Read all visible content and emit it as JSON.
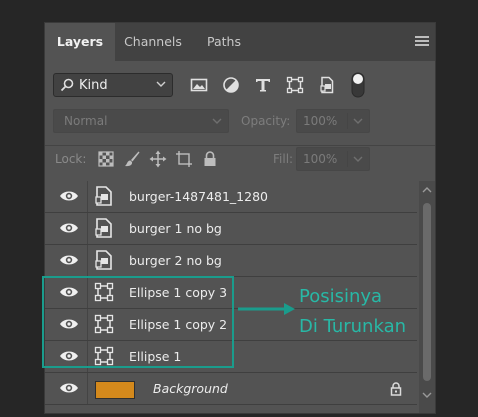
{
  "tabs": [
    {
      "label": "Layers",
      "active": true
    },
    {
      "label": "Channels",
      "active": false
    },
    {
      "label": "Paths",
      "active": false
    }
  ],
  "filter": {
    "kind_label": "Kind",
    "icons": [
      "image-filter-icon",
      "adjustment-filter-icon",
      "type-filter-icon",
      "shape-filter-icon",
      "smart-object-filter-icon",
      "filter-toggle-icon"
    ]
  },
  "blend": {
    "mode": "Normal",
    "opacity_label": "Opacity:",
    "opacity_value": "100%"
  },
  "lock": {
    "label": "Lock:",
    "icons": [
      "lock-transparent-pixels-icon",
      "lock-image-pixels-icon",
      "lock-position-icon",
      "lock-artboard-icon",
      "lock-all-icon"
    ],
    "fill_label": "Fill:",
    "fill_value": "100%"
  },
  "layers": [
    {
      "name": "burger-1487481_1280",
      "type": "smart-object"
    },
    {
      "name": "burger 1 no bg",
      "type": "smart-object"
    },
    {
      "name": "burger 2 no bg",
      "type": "smart-object"
    },
    {
      "name": "Ellipse 1 copy 3",
      "type": "shape"
    },
    {
      "name": "Ellipse 1 copy 2",
      "type": "shape"
    },
    {
      "name": "Ellipse 1",
      "type": "shape"
    },
    {
      "name": "Background",
      "type": "background",
      "locked": true
    }
  ],
  "annotation": {
    "line1": "Posisinya",
    "line2": "Di Turunkan",
    "color": "#28b8a6"
  },
  "colors": {
    "panel": "#535353",
    "tab_bar": "#424242",
    "background_swatch": "#d4891c",
    "highlight": "#1a9c8c"
  }
}
